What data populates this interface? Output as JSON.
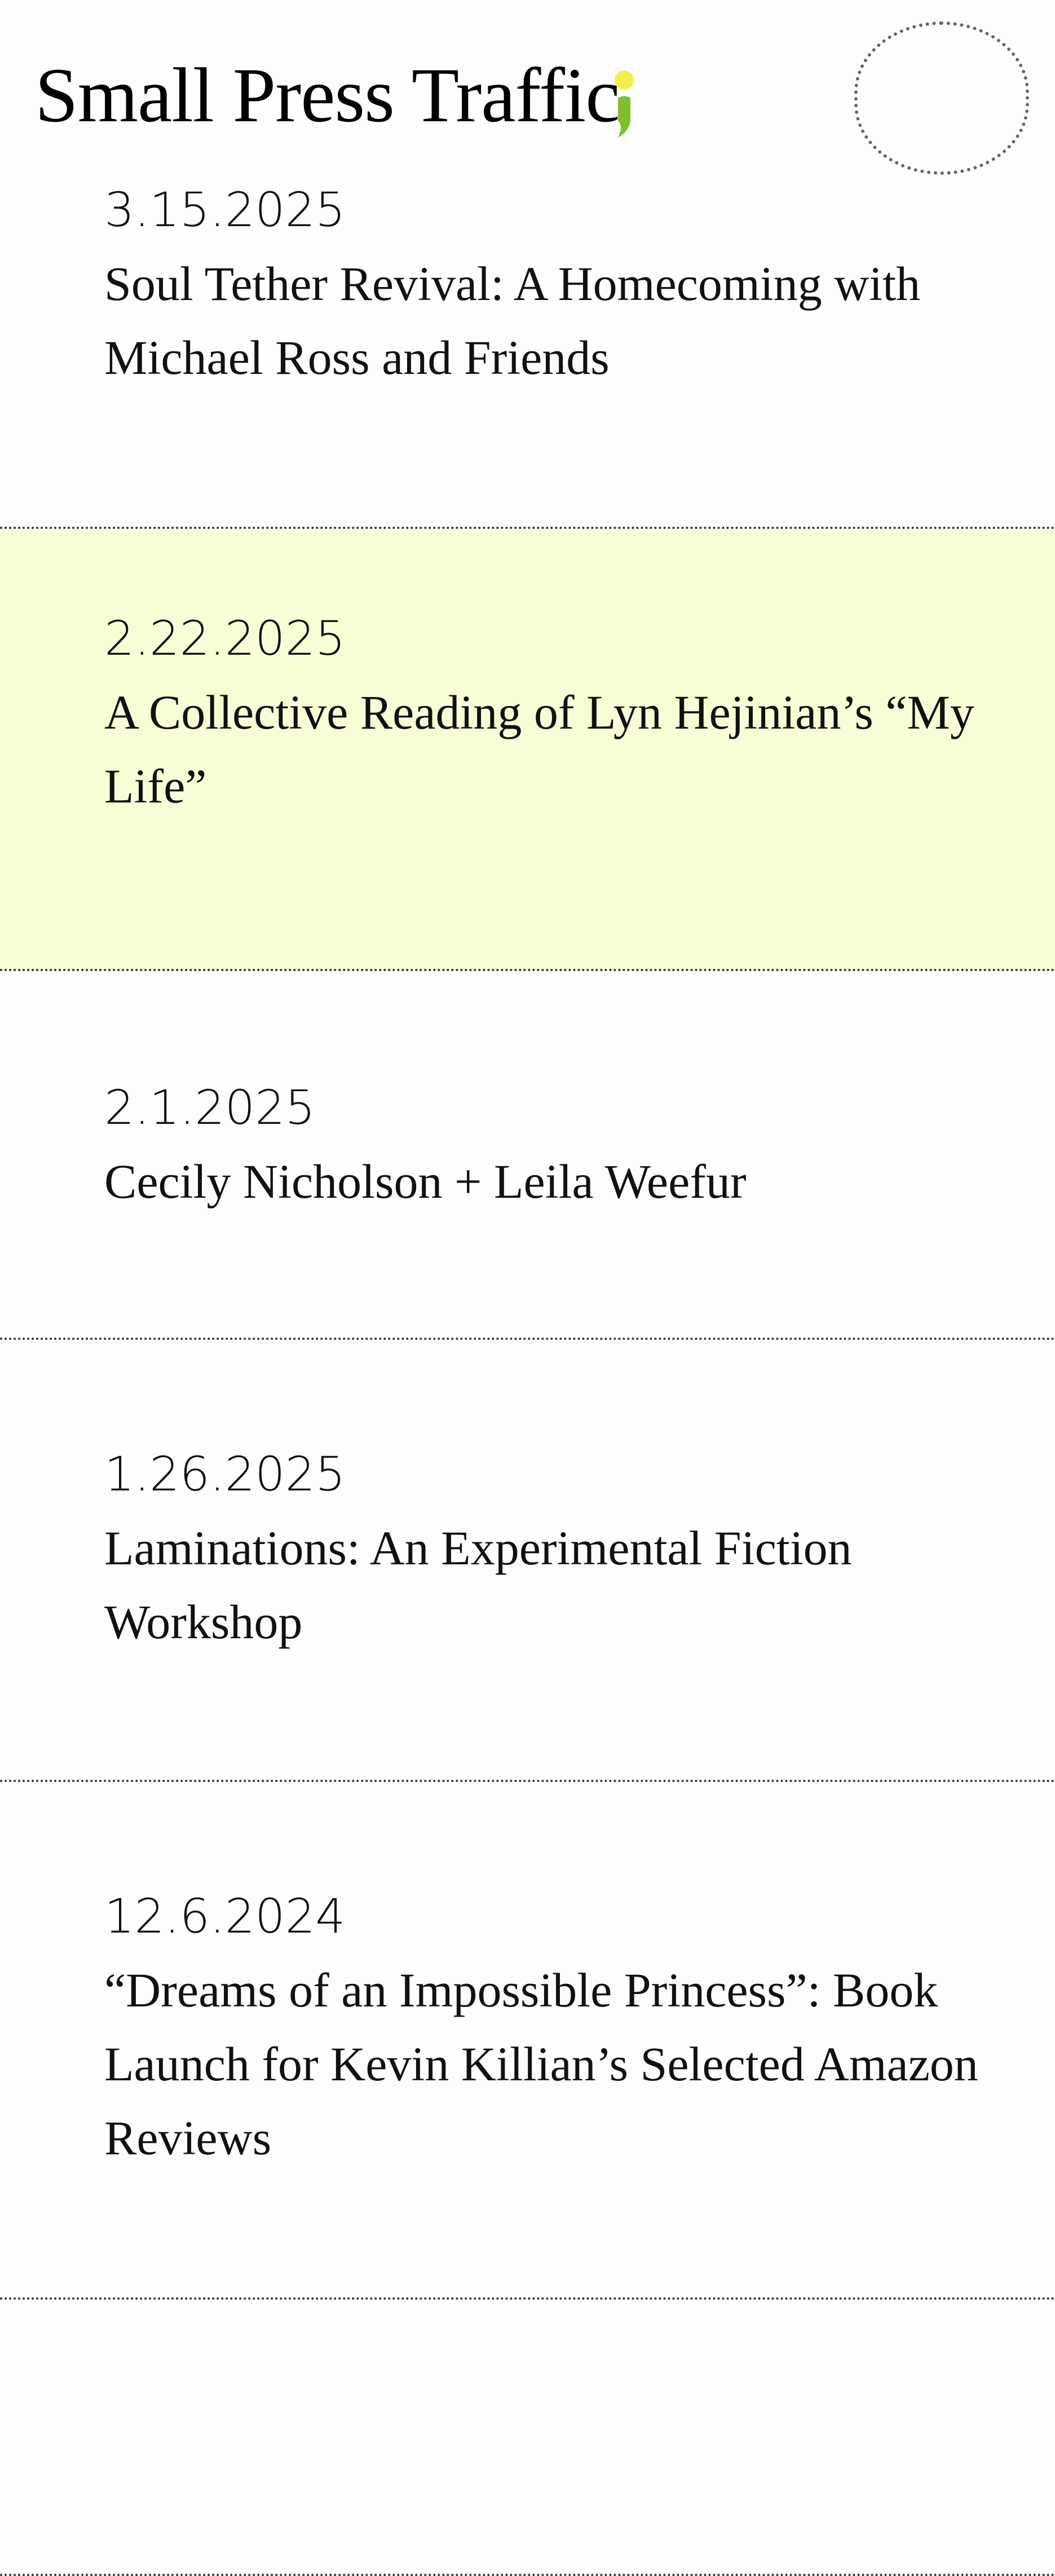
{
  "site": {
    "title": "Small Press Traffic",
    "logo_colors": {
      "dot": "#f2ef4a",
      "tail": "#7fbe2e"
    },
    "menu_icon": "circle-menu-icon"
  },
  "events": [
    {
      "date": "3.15.2025",
      "title": "Soul Tether Revival: A Homecoming with Michael Ross and Friends"
    },
    {
      "date": "2.22.2025",
      "title": "A Collective Reading of Lyn Hejinian’s “My Life”",
      "highlighted": true
    },
    {
      "date": "2.1.2025",
      "title": "Cecily Nicholson + Leila Weefur"
    },
    {
      "date": "1.26.2025",
      "title": "Laminations: An Experimental Fiction Workshop"
    },
    {
      "date": "12.6.2024",
      "title": "“Dreams of an Impossible Princess”: Book Launch for Kevin Killian’s Selected Amazon Reviews"
    }
  ],
  "colors": {
    "background": "#fdfdfd",
    "highlight": "#f7fdd5",
    "divider": "#333333"
  }
}
